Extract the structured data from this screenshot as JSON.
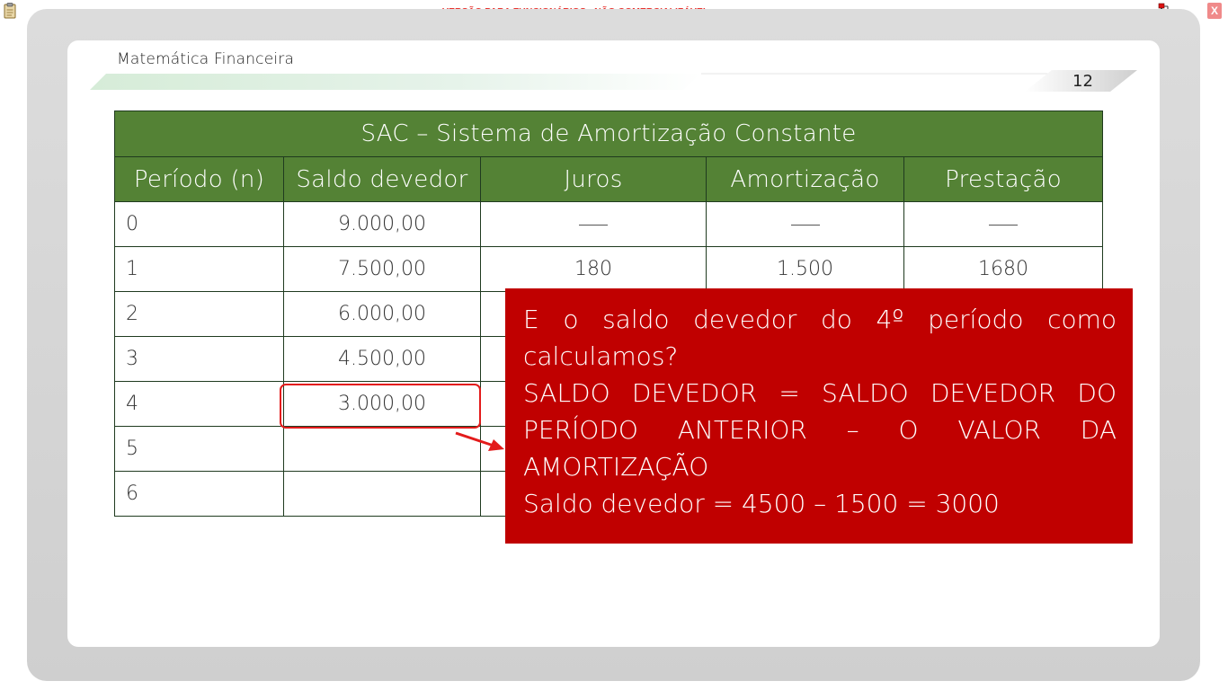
{
  "viewer": {
    "banner": "VERSÃO PARA FUNCIONÁRIOS - NÃO COMERCIALIZÁVEL",
    "close_label": "X",
    "icons": [
      "clipboard-icon",
      "network-icon"
    ]
  },
  "slide": {
    "course_title": "Matemática Financeira",
    "page_number": "12"
  },
  "table": {
    "title": "SAC – Sistema de Amortização Constante",
    "headers": [
      "Período (n)",
      "Saldo devedor",
      "Juros",
      "Amortização",
      "Prestação"
    ],
    "rows": [
      [
        "0",
        "9.000,00",
        "-----",
        "-----",
        "-----"
      ],
      [
        "1",
        "7.500,00",
        "180",
        "1.500",
        "1680"
      ],
      [
        "2",
        "6.000,00",
        "",
        "",
        ""
      ],
      [
        "3",
        "4.500,00",
        "",
        "",
        ""
      ],
      [
        "4",
        "3.000,00",
        "",
        "",
        ""
      ],
      [
        "5",
        "",
        "",
        "",
        ""
      ],
      [
        "6",
        "",
        "",
        "",
        ""
      ]
    ]
  },
  "callout": {
    "question": "E o saldo devedor do 4º período como calculamos?",
    "rule": "SALDO DEVEDOR = SALDO DEVEDOR DO PERÍODO ANTERIOR – O VALOR DA AMORTIZAÇÃO",
    "calculation": "Saldo devedor = 4500 – 1500 = 3000"
  },
  "colors": {
    "header_green": "#548235",
    "callout_red": "#c00000",
    "highlight_red": "#e31b1b",
    "banner_red": "#e8332e"
  }
}
